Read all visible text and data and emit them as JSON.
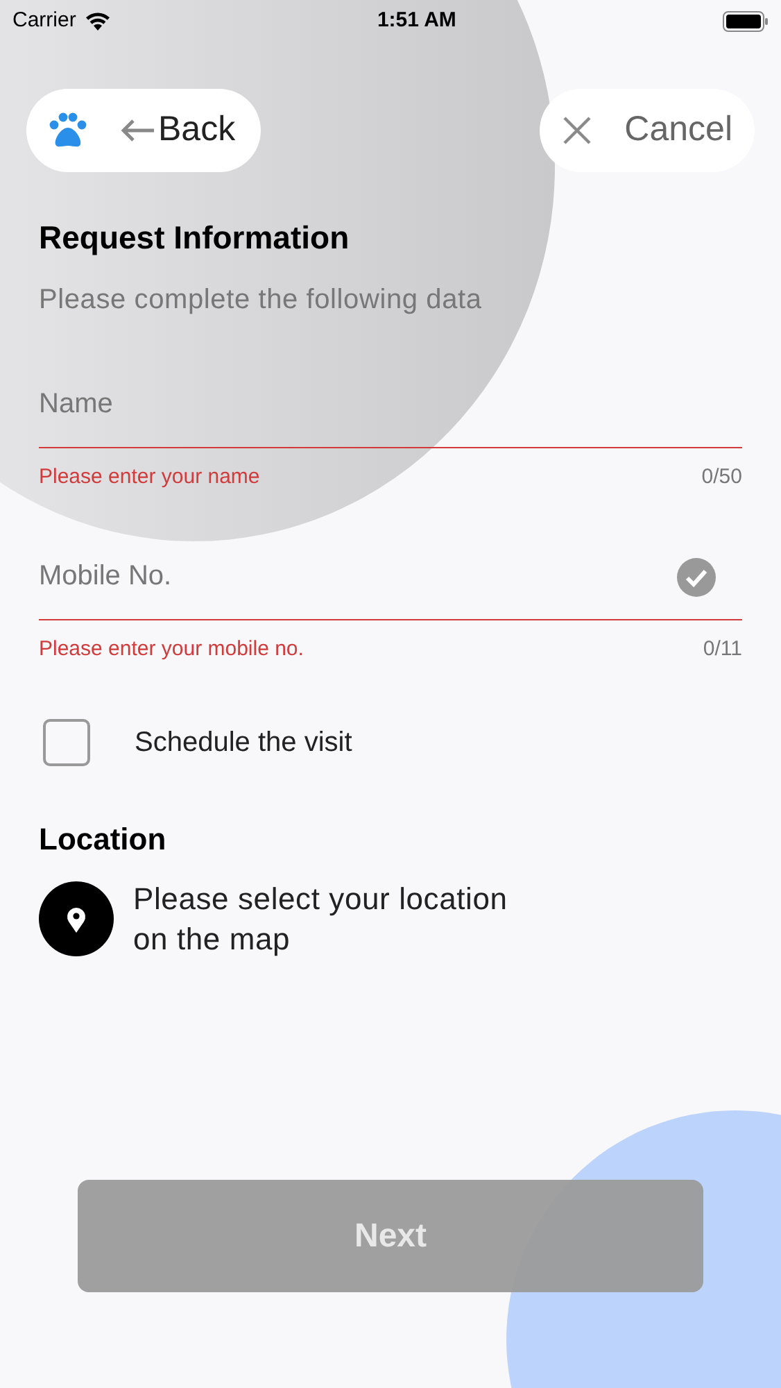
{
  "status_bar": {
    "carrier": "Carrier",
    "time": "1:51 AM"
  },
  "nav": {
    "back_label": "Back",
    "cancel_label": "Cancel"
  },
  "title": "Request Information",
  "subtitle": "Please complete the following data",
  "fields": [
    {
      "placeholder": "Name",
      "error": "Please enter your name",
      "counter": "0/50",
      "check_shown": false
    },
    {
      "placeholder": "Mobile No.",
      "error": "Please enter your mobile no.",
      "counter": "0/11",
      "check_shown": true
    }
  ],
  "schedule": {
    "label": "Schedule the visit",
    "checked": false
  },
  "location": {
    "heading": "Location",
    "prompt": "Please select your location on the map"
  },
  "next_button": {
    "label": "Next",
    "disabled": true
  }
}
